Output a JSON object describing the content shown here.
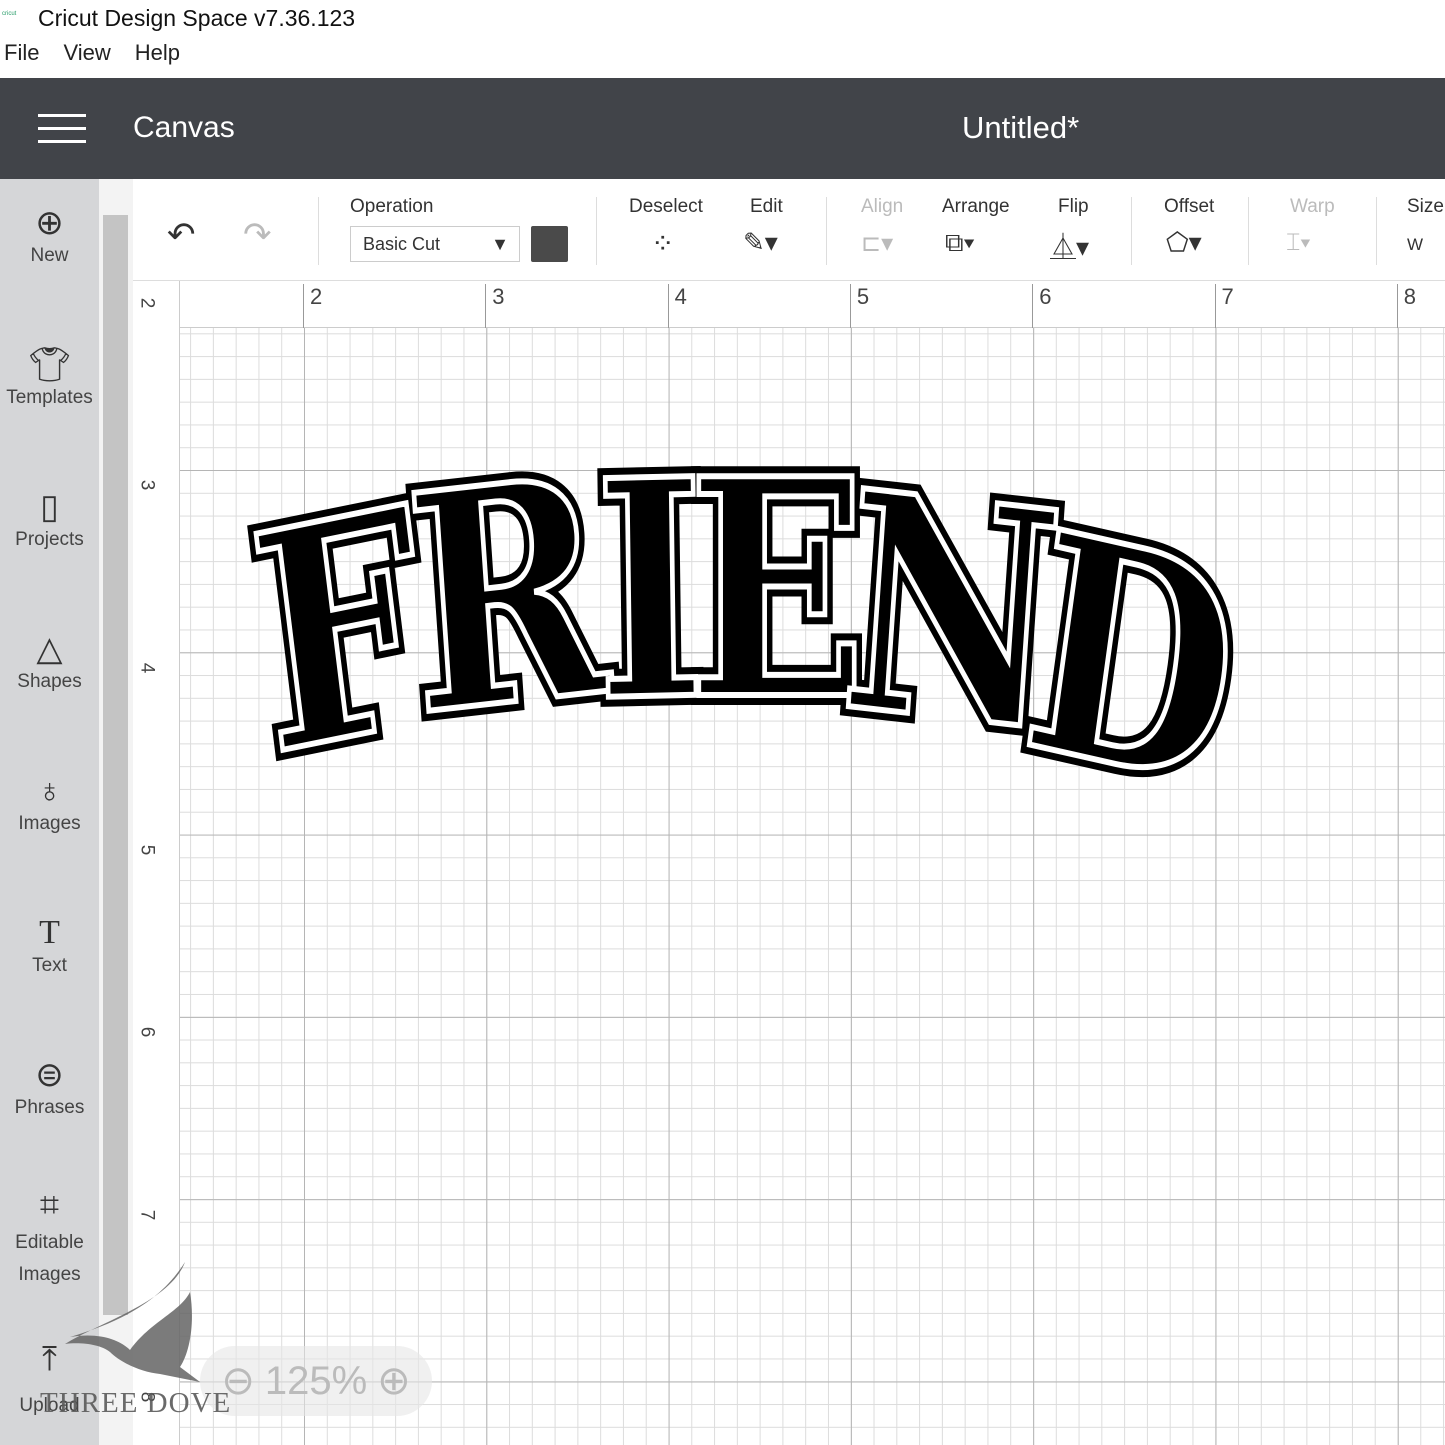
{
  "app": {
    "logo": "cricut",
    "title": "Cricut Design Space  v7.36.123"
  },
  "menu": [
    "File",
    "View",
    "Help"
  ],
  "header": {
    "section": "Canvas",
    "document": "Untitled*"
  },
  "sidebar": [
    {
      "label": "New",
      "icon": "plus-circle"
    },
    {
      "label": "Templates",
      "icon": "shirt"
    },
    {
      "label": "Projects",
      "icon": "clipboard"
    },
    {
      "label": "Shapes",
      "icon": "shapes"
    },
    {
      "label": "Images",
      "icon": "bulb"
    },
    {
      "label": "Text",
      "icon": "T"
    },
    {
      "label": "Phrases",
      "icon": "speech-bubble"
    },
    {
      "label": "Editable Images",
      "icon": "vector"
    },
    {
      "label": "Upload",
      "icon": "upload"
    }
  ],
  "toolbar": {
    "operation_label": "Operation",
    "operation_value": "Basic Cut",
    "color": "#4a4a4a",
    "deselect": "Deselect",
    "edit": "Edit",
    "align": "Align",
    "arrange": "Arrange",
    "flip": "Flip",
    "offset": "Offset",
    "warp": "Warp",
    "size": "Size",
    "size_w": "W"
  },
  "ruler": {
    "top": [
      "2",
      "3",
      "4",
      "5",
      "6",
      "7",
      "8"
    ],
    "left": [
      "2",
      "3",
      "4",
      "5",
      "6",
      "7",
      "8"
    ]
  },
  "canvas": {
    "text": "FRIEND"
  },
  "zoom": {
    "level": "125%"
  },
  "watermark": "THREE DOVE"
}
